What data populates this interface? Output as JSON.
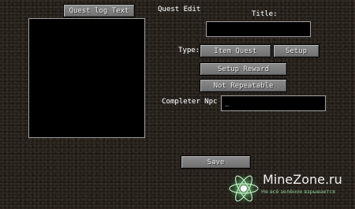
{
  "header": {
    "quest_log_button": "Quest log Text",
    "title": "Quest Edit"
  },
  "form": {
    "title_label": "Title:",
    "title_value": "",
    "type_label": "Type:",
    "item_quest_button": "Item Quest",
    "setup_button": "Setup",
    "setup_reward_button": "Setup Reward",
    "not_repeatable_button": "Not Repeatable",
    "completer_npc_label": "Completer Npc",
    "completer_npc_value": "_",
    "save_button": "Save"
  },
  "watermark": {
    "title": "MineZone.ru",
    "subtitle": "Не всё зелёное взрывается"
  },
  "colors": {
    "button": "#7a7a7a",
    "field_border": "#a0a0a0",
    "text": "#ffffff"
  },
  "icons": [
    "atom-logo-icon"
  ]
}
